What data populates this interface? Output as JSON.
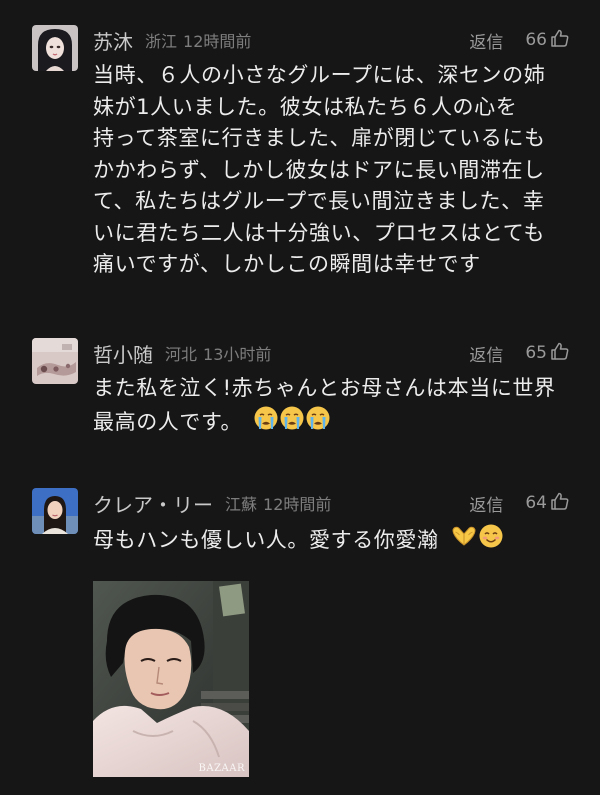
{
  "comments": [
    {
      "username": "苏沐",
      "location": "浙江",
      "time": "12時間前",
      "reply_label": "返信",
      "likes": "66",
      "text_lines": [
        "当時、６人の小さなグループには、深センの姉",
        "妹が1人いました。彼女は私たち６人の心を",
        "持って茶室に行きました、扉が閉じているにも",
        "かかわらず、しかし彼女はドアに長い間滞在し",
        "て、私たちはグループで長い間泣きました、幸",
        "いに君たち二人は十分強い、プロセスはとても",
        "痛いですが、しかしこの瞬間は幸せです"
      ]
    },
    {
      "username": "哲小随",
      "location": "河北",
      "time": "13小时前",
      "reply_label": "返信",
      "likes": "65",
      "text_lines": [
        "また私を泣く!赤ちゃんとお母さんは本当に世界",
        "最高の人です。"
      ],
      "emojis": [
        "crying-face",
        "crying-face",
        "crying-face"
      ]
    },
    {
      "username": "クレア・リー",
      "location": "江蘇",
      "time": "12時間前",
      "reply_label": "返信",
      "likes": "64",
      "text_lines": [
        "母もハンも優しい人。愛する你愛瀚"
      ],
      "emojis": [
        "heart-hands",
        "smiling-face"
      ],
      "photo_watermark": "BAZAAR"
    }
  ],
  "colors": {
    "background": "#161616",
    "username": "#c9c9c9",
    "meta": "#7d7d7d",
    "text": "#ececec"
  },
  "icons": {
    "like": "thumbs-up-icon"
  }
}
